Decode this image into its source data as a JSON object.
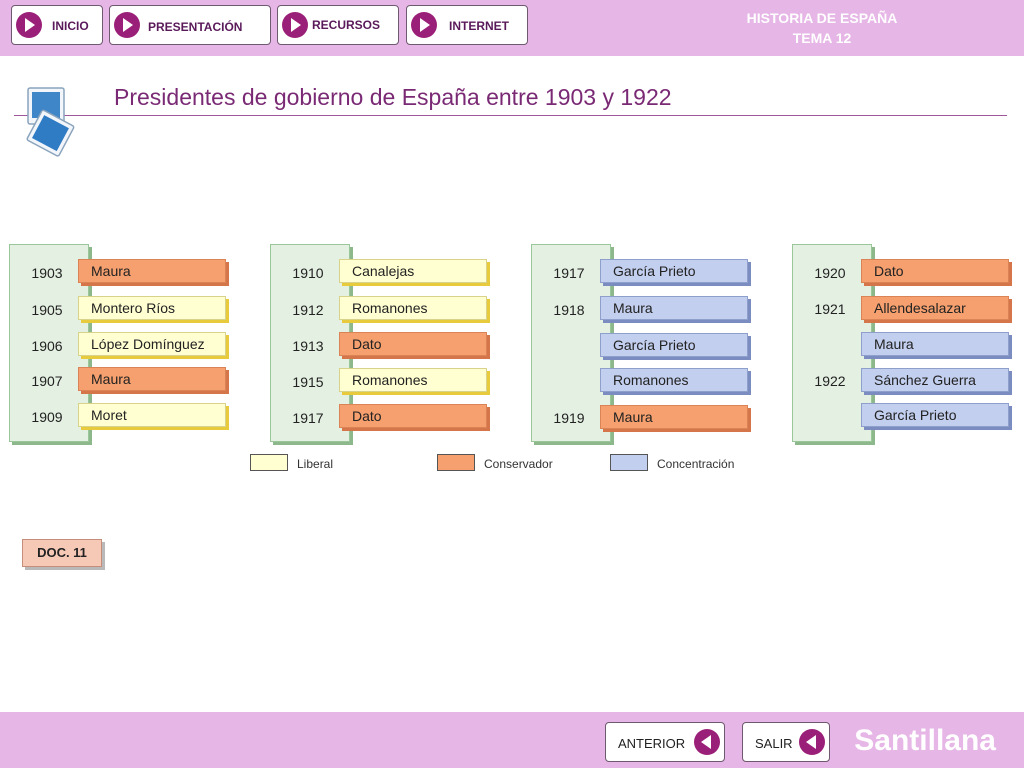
{
  "nav": {
    "items": [
      {
        "label": "INICIO"
      },
      {
        "label": "PRESENTACIÓN"
      },
      {
        "label": "RECURSOS"
      },
      {
        "label": "INTERNET"
      }
    ]
  },
  "course": {
    "subject": "HISTORIA DE ESPAÑA",
    "unit": "TEMA 12"
  },
  "page": {
    "title": "Presidentes de gobierno de España entre 1903 y 1922"
  },
  "icons": {
    "title": "presentation-slides-icon",
    "nav": "play-arrow-icon",
    "back": "back-arrow-icon"
  },
  "colors": {
    "liberal": "#ffffd2",
    "conservador": "#f5a06e",
    "concentracion": "#c3cfee",
    "accent": "#9a1f78",
    "bar": "#e6b6e6"
  },
  "timeline": {
    "columns": [
      {
        "rows": [
          {
            "year": "1903",
            "name": "Maura",
            "party": "conservador"
          },
          {
            "year": "1905",
            "name": "Montero Ríos",
            "party": "liberal"
          },
          {
            "year": "1906",
            "name": "López Domínguez",
            "party": "liberal"
          },
          {
            "year": "1907",
            "name": "Maura",
            "party": "conservador"
          },
          {
            "year": "1909",
            "name": "Moret",
            "party": "liberal"
          }
        ]
      },
      {
        "rows": [
          {
            "year": "1910",
            "name": "Canalejas",
            "party": "liberal"
          },
          {
            "year": "1912",
            "name": "Romanones",
            "party": "liberal"
          },
          {
            "year": "1913",
            "name": "Dato",
            "party": "conservador"
          },
          {
            "year": "1915",
            "name": "Romanones",
            "party": "liberal"
          },
          {
            "year": "1917",
            "name": "Dato",
            "party": "conservador"
          }
        ]
      },
      {
        "rows": [
          {
            "year": "1917",
            "name": "García Prieto",
            "party": "concentracion"
          },
          {
            "year": "1918",
            "name": "Maura",
            "party": "concentracion"
          },
          {
            "year": "",
            "name": "García Prieto",
            "party": "concentracion"
          },
          {
            "year": "",
            "name": "Romanones",
            "party": "concentracion"
          },
          {
            "year": "1919",
            "name": "Maura",
            "party": "conservador"
          }
        ]
      },
      {
        "rows": [
          {
            "year": "1920",
            "name": "Dato",
            "party": "conservador"
          },
          {
            "year": "1921",
            "name": "Allendesalazar",
            "party": "conservador"
          },
          {
            "year": "",
            "name": "Maura",
            "party": "concentracion"
          },
          {
            "year": "1922",
            "name": "Sánchez Guerra",
            "party": "concentracion"
          },
          {
            "year": "",
            "name": "García Prieto",
            "party": "concentracion"
          }
        ]
      }
    ]
  },
  "legend": {
    "liberal": "Liberal",
    "conservador": "Conservador",
    "concentracion": "Concentración"
  },
  "doc": {
    "label": "DOC. 11"
  },
  "footer": {
    "prev_label": "ANTERIOR",
    "exit_label": "SALIR",
    "brand": "Santillana"
  }
}
